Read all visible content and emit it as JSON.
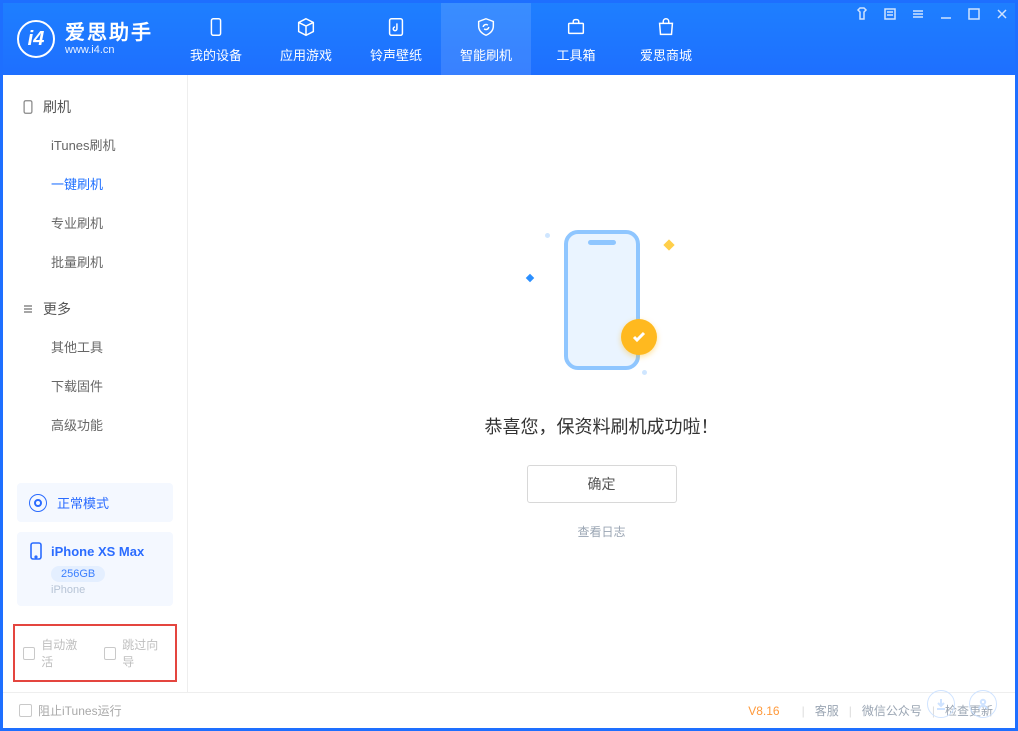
{
  "app": {
    "name_cn": "爱思助手",
    "name_en": "www.i4.cn"
  },
  "nav": {
    "items": [
      {
        "label": "我的设备"
      },
      {
        "label": "应用游戏"
      },
      {
        "label": "铃声壁纸"
      },
      {
        "label": "智能刷机"
      },
      {
        "label": "工具箱"
      },
      {
        "label": "爱思商城"
      }
    ],
    "active_index": 3
  },
  "sidebar": {
    "sections": [
      {
        "title": "刷机",
        "items": [
          "iTunes刷机",
          "一键刷机",
          "专业刷机",
          "批量刷机"
        ],
        "active_index": 1
      },
      {
        "title": "更多",
        "items": [
          "其他工具",
          "下载固件",
          "高级功能"
        ],
        "active_index": -1
      }
    ],
    "mode_label": "正常模式",
    "device": {
      "name": "iPhone XS Max",
      "capacity": "256GB",
      "type": "iPhone"
    },
    "checkboxes": {
      "auto_activate": "自动激活",
      "skip_guide": "跳过向导"
    }
  },
  "main": {
    "success_message": "恭喜您，保资料刷机成功啦！",
    "ok_button": "确定",
    "view_log": "查看日志"
  },
  "footer": {
    "block_itunes": "阻止iTunes运行",
    "version": "V8.16",
    "links": [
      "客服",
      "微信公众号",
      "检查更新"
    ]
  }
}
